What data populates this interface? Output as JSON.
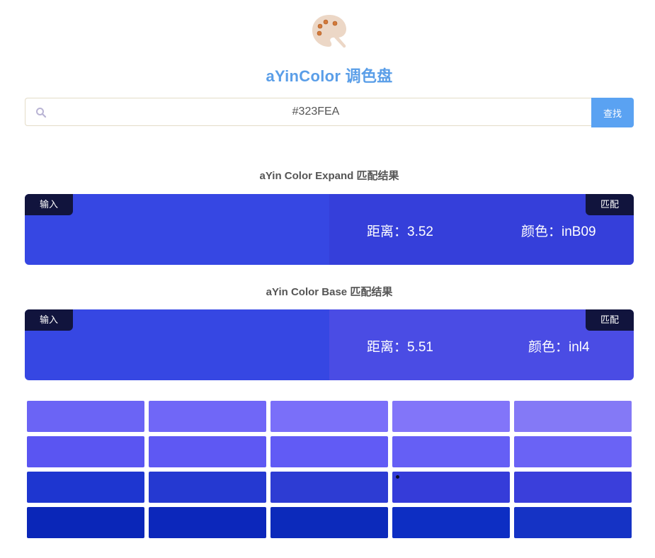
{
  "header": {
    "logo_icon": "palette-icon",
    "title": "aYinColor 调色盘"
  },
  "search": {
    "value": "#323FEA",
    "placeholder": "",
    "button_label": "查找",
    "icon": "search-icon"
  },
  "sections": [
    {
      "title": "aYin Color Expand 匹配结果",
      "input_label": "输入",
      "match_label": "匹配",
      "input_color": "#3647e3",
      "match_color": "#353fda",
      "distance_text": "距离：3.52",
      "color_text": "颜色：inB09"
    },
    {
      "title": "aYin Color Base 匹配结果",
      "input_label": "输入",
      "match_label": "匹配",
      "input_color": "#3647e3",
      "match_color": "#4a4ce4",
      "distance_text": "距离：5.51",
      "color_text": "颜色：inl4"
    }
  ],
  "swatches": [
    [
      "#6b64f5",
      "#7067f7",
      "#7a6ff9",
      "#8275f9",
      "#8479f6"
    ],
    [
      "#5a55f2",
      "#5e58f3",
      "#615bf5",
      "#655ff5",
      "#6a63f5"
    ],
    [
      "#1e36d0",
      "#2539d1",
      "#2d3cd3",
      "#353cd9",
      "#3a3fdb"
    ],
    [
      "#0a26b8",
      "#0c27bb",
      "#0c2abb",
      "#0d2ec3",
      "#1533c5"
    ]
  ],
  "selected_swatch": {
    "row": 2,
    "col": 3
  }
}
